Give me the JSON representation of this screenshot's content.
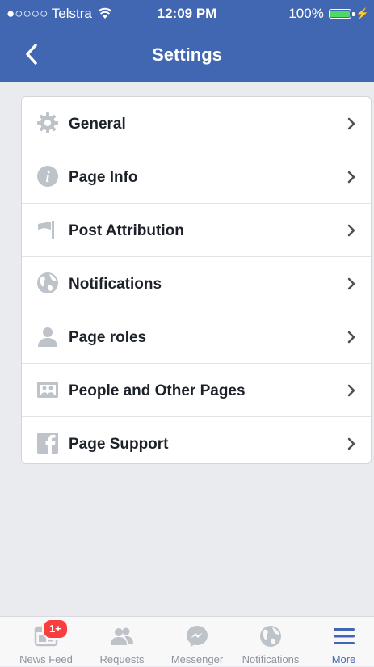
{
  "status_bar": {
    "carrier": "●○○○○ Telstra",
    "time": "12:09 PM",
    "battery": "100%"
  },
  "nav": {
    "title": "Settings"
  },
  "settings": {
    "items": [
      {
        "label": "General",
        "icon": "gear-icon"
      },
      {
        "label": "Page Info",
        "icon": "info-icon"
      },
      {
        "label": "Post Attribution",
        "icon": "flag-icon"
      },
      {
        "label": "Notifications",
        "icon": "globe-icon"
      },
      {
        "label": "Page roles",
        "icon": "person-icon"
      },
      {
        "label": "People and Other Pages",
        "icon": "people-icon"
      },
      {
        "label": "Page Support",
        "icon": "facebook-icon"
      }
    ]
  },
  "tabbar": {
    "tabs": [
      {
        "label": "News Feed",
        "icon": "news-feed-icon",
        "badge": "1+"
      },
      {
        "label": "Requests",
        "icon": "friend-requests-icon"
      },
      {
        "label": "Messenger",
        "icon": "messenger-icon"
      },
      {
        "label": "Notifications",
        "icon": "globe-icon"
      },
      {
        "label": "More",
        "icon": "menu-icon",
        "active": true
      }
    ]
  },
  "colors": {
    "header": "#4267b2",
    "background": "#e9ebee",
    "icon_gray": "#bec2c9",
    "badge": "#fa3e3e"
  }
}
